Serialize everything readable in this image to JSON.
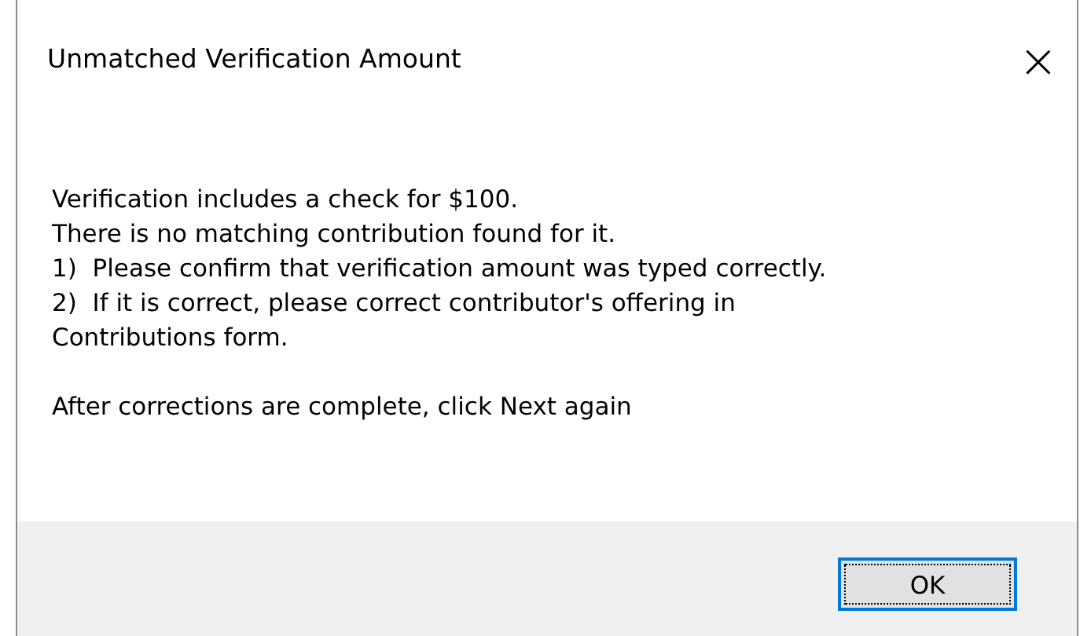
{
  "window": {
    "title": "Unmatched Verification Amount",
    "close": "×"
  },
  "message": {
    "lines": [
      "Verification includes a check for $100.",
      "There is no matching contribution found for it.",
      "1)  Please confirm that verification amount was typed correctly.",
      "2)  If it is correct, please correct contributor's offering in",
      "Contributions form."
    ],
    "note": "After corrections are complete, click Next again"
  },
  "buttons": [
    {
      "label": "OK",
      "focused": true
    }
  ]
}
